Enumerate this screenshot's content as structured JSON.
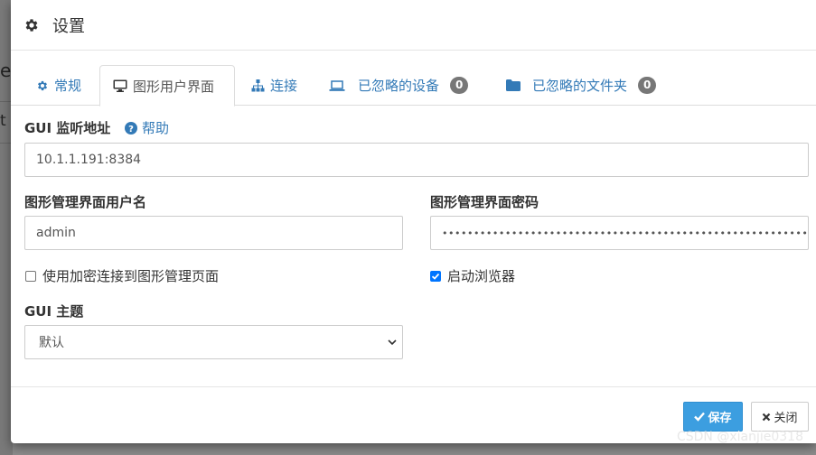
{
  "background": {
    "frag_a": "e)",
    "frag_b": "t"
  },
  "dialog": {
    "title": "设置",
    "title_icon": "gear-icon"
  },
  "tabs": [
    {
      "label": "常规",
      "icon": "gear-icon"
    },
    {
      "label": "图形用户界面",
      "icon": "desktop-icon"
    },
    {
      "label": "连接",
      "icon": "network-icon"
    },
    {
      "label": "已忽略的设备",
      "icon": "laptop-icon",
      "badge": "0"
    },
    {
      "label": "已忽略的文件夹",
      "icon": "folder-icon",
      "badge": "0"
    }
  ],
  "gui": {
    "listen_label": "GUI 监听地址",
    "help_label": "帮助",
    "listen_value": "10.1.1.191:8384",
    "username_label": "图形管理界面用户名",
    "username_value": "admin",
    "password_label": "图形管理界面密码",
    "password_value": "••••••••••••••••••••••••••••••••••••••••••••••••••••••••••••",
    "https_label": "使用加密连接到图形管理页面",
    "https_checked": false,
    "browser_label": "启动浏览器",
    "browser_checked": true,
    "theme_label": "GUI 主题",
    "theme_value": "默认"
  },
  "footer": {
    "save_label": "保存",
    "close_label": "关闭"
  },
  "watermark": "CSDN @xianjie0318",
  "colors": {
    "link": "#337ab7",
    "primary": "#3c9ee0",
    "badge": "#777777",
    "checkbox": "#0075ff"
  }
}
